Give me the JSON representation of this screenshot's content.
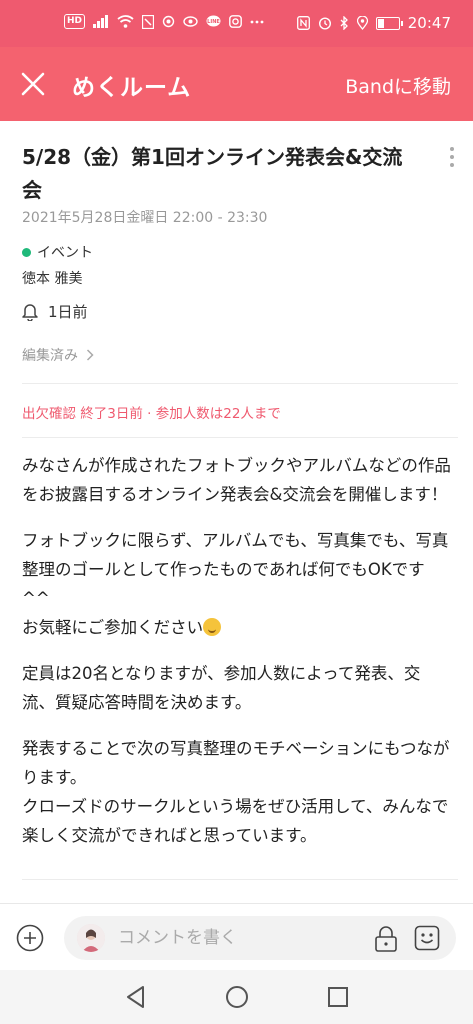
{
  "status_bar": {
    "hd_badge": "HD",
    "time": "20:47",
    "battery_level": 0.3,
    "left_icons": [
      "hd-icon",
      "signal-icon",
      "wifi-icon",
      "app-notification-icon",
      "link-icon",
      "eye-icon",
      "line-icon",
      "instagram-icon",
      "more-dots-icon"
    ],
    "right_icons": [
      "nfc-icon",
      "alarm-icon",
      "bluetooth-icon",
      "location-icon",
      "battery-icon"
    ]
  },
  "header": {
    "title": "めくルーム",
    "action": "Bandに移動",
    "background": "#f4626f"
  },
  "post": {
    "title": "5/28（金）第1回オンライン発表会&交流会",
    "datetime": "2021年5月28日金曜日 22:00 - 23:30",
    "category": "イベント",
    "author": "徳本 雅美",
    "reminder": "1日前",
    "edited": "編集済み",
    "attendance": "出欠確認 終了3日前 · 参加人数は22人まで",
    "body": {
      "p1": "みなさんが作成されたフォトブックやアルバムなどの作品をお披露目するオンライン発表会&交流会を開催します！",
      "p2_line1": "フォトブックに限らず、アルバムでも、写真集でも、写真整理のゴールとして作ったものであれば何でもOKです^^",
      "p2_line2": "お気軽にご参加ください",
      "p3": "定員は20名となりますが、参加人数によって発表、交流、質疑応答時間を決めます。",
      "p4_line1": "発表することで次の写真整理のモチベーションにもつながります。",
      "p4_line2": "クローズドのサークルという場をぜひ活用して、みんなで楽しく交流ができればと思っています。"
    }
  },
  "comment_bar": {
    "placeholder": "コメントを書く"
  },
  "colors": {
    "accent": "#f4626f",
    "event_dot": "#1fb97a",
    "attendance_text": "#ef5a6f"
  }
}
